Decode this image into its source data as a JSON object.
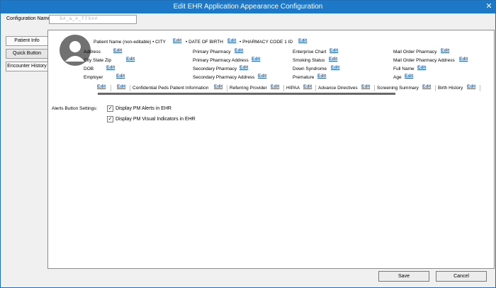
{
  "window": {
    "title": "Edit EHR Application Appearance Configuration",
    "close": "✕"
  },
  "config": {
    "label": "Configuration Name:",
    "value": "S#_a_#_TTS##"
  },
  "sidebar": {
    "items": [
      {
        "label": "Patient Info"
      },
      {
        "label": "Quick Button"
      },
      {
        "label": "Encounter History"
      }
    ]
  },
  "patient": {
    "header_line": "Patient Name (non-editable)  •  CITY",
    "dob_header": "•  DATE OF BIRTH",
    "pharm_header": "•  PHARMACY CODE 1 ID",
    "edit": "Edit",
    "col1": [
      "Address",
      "City State Zip",
      "DOB",
      "Employer"
    ],
    "col2": [
      "Primary Pharmacy",
      "Primary Pharmacy Address",
      "Secondary Pharmacy",
      "Secondary Pharmacy Address"
    ],
    "col3": [
      "Enterprise Chart",
      "Smoking Status",
      "Down Syndrome",
      "Premature"
    ],
    "col4": [
      "Mail Order Pharmacy",
      "Mail Order Pharmacy Address",
      "Full Name",
      "Age"
    ],
    "tabs": [
      "Confidential Peds Patient Information",
      "Referring Provider",
      "HIPAA",
      "Advance Directives",
      "Screening Summary",
      "Birth History"
    ]
  },
  "alerts": {
    "label": "Alerts Button Settings:",
    "options": [
      {
        "label": "Display PM Alerts in EHR",
        "checked": "✓"
      },
      {
        "label": "Display PM Visual Indicators in EHR",
        "checked": "✓"
      }
    ]
  },
  "footer": {
    "save": "Save",
    "cancel": "Cancel"
  }
}
